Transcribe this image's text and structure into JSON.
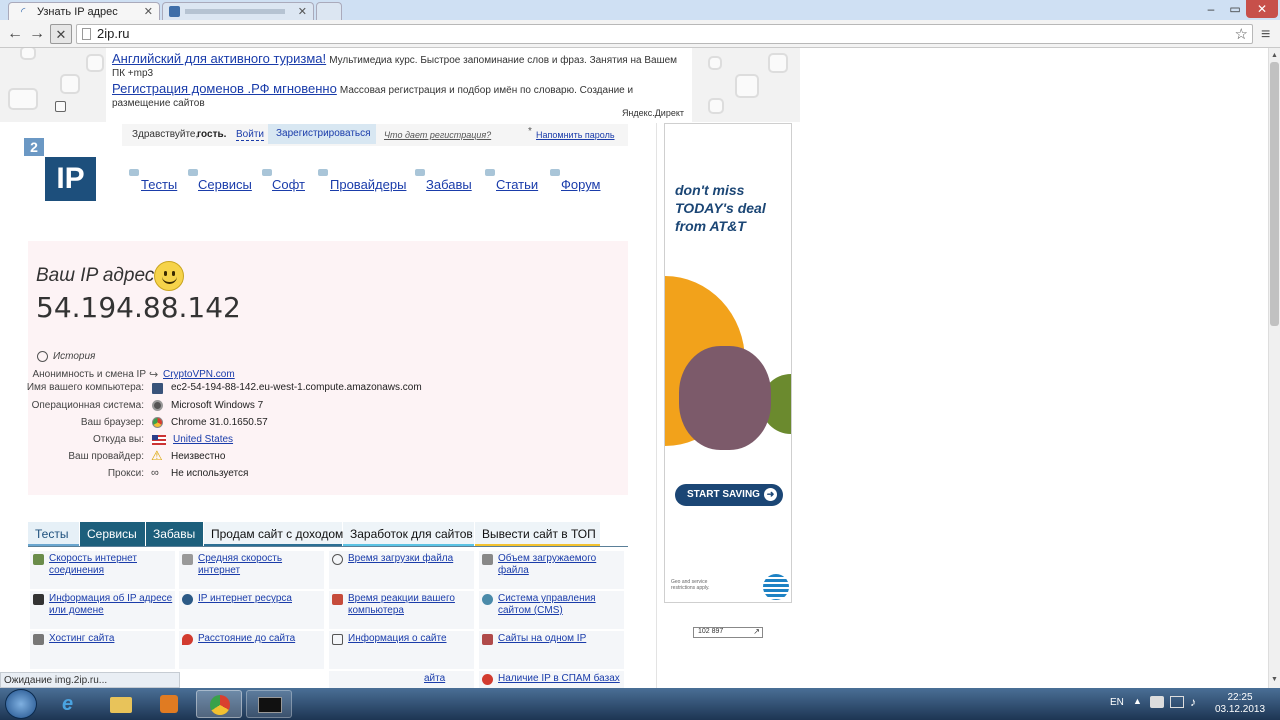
{
  "browser": {
    "tabs": [
      {
        "title": "Узнать IP адрес"
      },
      {
        "title": ""
      },
      {
        "title": ""
      }
    ],
    "url": "2ip.ru",
    "status": "Ожидание img.2ip.ru..."
  },
  "direct": {
    "ads": [
      {
        "link": "Английский для активного туризма!",
        "desc": "Мультимедиа курс. Быстрое запоминание слов и фраз. Занятия на Вашем ПК +mp3"
      },
      {
        "link": "Регистрация доменов .РФ мгновенно",
        "desc": "Массовая регистрация и подбор имён по словарю. Создание и размещение сайтов"
      }
    ],
    "brand": "Яндекс.Директ"
  },
  "login": {
    "greeting": "Здравствуйте,",
    "guest": "гость.",
    "enter": "Войти",
    "register": "Зарегистрироваться",
    "why": "Что дает регистрация?",
    "asterisk": "*",
    "remind": "Напомнить пароль"
  },
  "logo": {
    "badge": "2",
    "text": "IP"
  },
  "nav": [
    "Тесты",
    "Сервисы",
    "Софт",
    "Провайдеры",
    "Забавы",
    "Статьи",
    "Форум"
  ],
  "ip": {
    "title": "Ваш IP адрес:",
    "address": "54.194.88.142",
    "history": "История",
    "rows": [
      {
        "label": "Анонимность и смена IP",
        "value": "CryptoVPN.com"
      },
      {
        "label": "Имя вашего компьютера:",
        "value": "ec2-54-194-88-142.eu-west-1.compute.amazonaws.com"
      },
      {
        "label": "Операционная система:",
        "value": "Microsoft Windows 7"
      },
      {
        "label": "Ваш браузер:",
        "value": "Chrome 31.0.1650.57"
      },
      {
        "label": "Откуда вы:",
        "value": "United States"
      },
      {
        "label": "Ваш провайдер:",
        "value": "Неизвестно"
      },
      {
        "label": "Прокси:",
        "value": "Не используется"
      }
    ]
  },
  "tabs": [
    "Тесты",
    "Сервисы",
    "Забавы",
    "Продам сайт с доходом",
    "Заработок для сайтов",
    "Вывести сайт в ТОП"
  ],
  "services": [
    "Скорость интернет соединения",
    "Средняя скорость интернет",
    "Время загрузки файла",
    "Объем загружаемого файла",
    "Информация об IP адресе или домене",
    "IP интернет ресурса",
    "Время реакции вашего компьютера",
    "Система управления сайтом (CMS)",
    "Хостинг сайта",
    "Расстояние до сайта",
    "Информация о сайте",
    "Сайты на одном IP",
    "",
    "",
    "айта",
    "Наличие IP в СПАМ базах"
  ],
  "ad": {
    "line1": "don't miss",
    "line2": "TODAY's deal",
    "line3": "from AT&T",
    "cta": "START SAVING",
    "fine": "Geo and service restrictions apply.",
    "counter": "102 897"
  },
  "taskbar": {
    "lang": "EN",
    "time": "22:25",
    "date": "03.12.2013"
  }
}
